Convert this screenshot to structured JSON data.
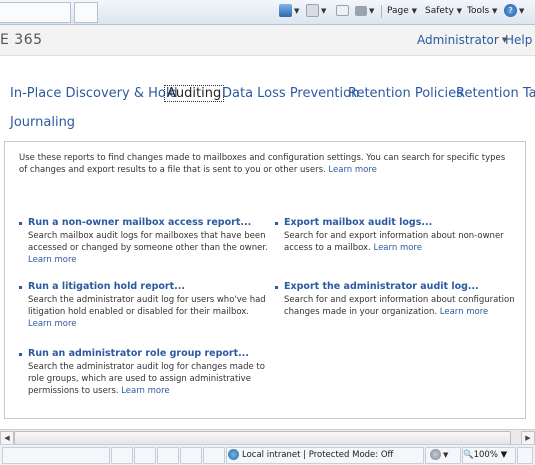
{
  "browser": {
    "toolbar": {
      "page_label": "Page",
      "safety_label": "Safety",
      "tools_label": "Tools"
    },
    "status_bar": {
      "zone_text": "Local intranet | Protected Mode: Off",
      "zoom_text": "100%"
    }
  },
  "header": {
    "brand_fragment": "E 365",
    "user_label": "Administrator",
    "help_label": "Help"
  },
  "tabs": [
    {
      "label": "In-Place Discovery & Hold",
      "selected": false
    },
    {
      "label": "Auditing",
      "selected": true
    },
    {
      "label": "Data Loss Prevention",
      "selected": false
    },
    {
      "label": "Retention Policies",
      "selected": false
    },
    {
      "label": "Retention Tag",
      "selected": false
    },
    {
      "label": "Journaling",
      "selected": false
    }
  ],
  "intro": {
    "text": "Use these reports to find changes made to mailboxes and configuration settings. You can search for specific types of changes and export results to a file that is sent to you or other users.",
    "link": "Learn more"
  },
  "reports": [
    {
      "title": "Run a non-owner mailbox access report...",
      "description": "Search mailbox audit logs for mailboxes that have been accessed or changed by someone other than the owner.",
      "link": "Learn more"
    },
    {
      "title": "Export mailbox audit logs...",
      "description": "Search for and export information about non-owner access to a mailbox.",
      "link": "Learn more"
    },
    {
      "title": "Run a litigation hold report...",
      "description": "Search the administrator audit log for users who've had litigation hold enabled or disabled for their mailbox.",
      "link": "Learn more"
    },
    {
      "title": "Export the administrator audit log...",
      "description": "Search for and export information about configuration changes made in your organization.",
      "link": "Learn more"
    },
    {
      "title": "Run an administrator role group report...",
      "description": "Search the administrator audit log for changes made to role groups, which are used to assign administrative permissions to users.",
      "link": "Learn more"
    }
  ],
  "colors": {
    "link": "#2c5aa0",
    "text": "#333333",
    "header_bg": "#f3f3f3"
  }
}
